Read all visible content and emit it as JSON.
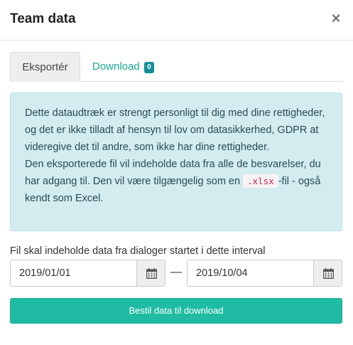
{
  "modal": {
    "title": "Team data",
    "close_symbol": "×",
    "close_icon": "close-icon"
  },
  "tabs": [
    {
      "label": "Eksportér",
      "active": true
    },
    {
      "label": "Download",
      "badge": "0",
      "active": false
    }
  ],
  "info": {
    "line1": "Dette dataudtræk er strengt personligt til dig med dine rettigheder, og det er ikke tilladt af hensyn til lov om datasikkerhed, GDPR at videregive det til andre, som ikke har dine rettigheder.",
    "line2_before": "Den eksporterede fil vil indeholde data fra alle de besvarelser, du har adgang til. Den vil være tilgængelig som en ",
    "code": ".xlsx",
    "line2_after": "-fil - også kendt som Excel."
  },
  "interval": {
    "label": "Fil skal indeholde data fra dialoger startet i dette interval",
    "from_value": "2019/01/01",
    "to_value": "2019/10/04",
    "separator": "—",
    "calendar_icon": "calendar-icon"
  },
  "submit": {
    "label": "Bestil data til download"
  },
  "colors": {
    "accent": "#20bba3",
    "tab_link": "#1aab94",
    "info_background": "#d2ecef",
    "badge": "#138f9a"
  }
}
